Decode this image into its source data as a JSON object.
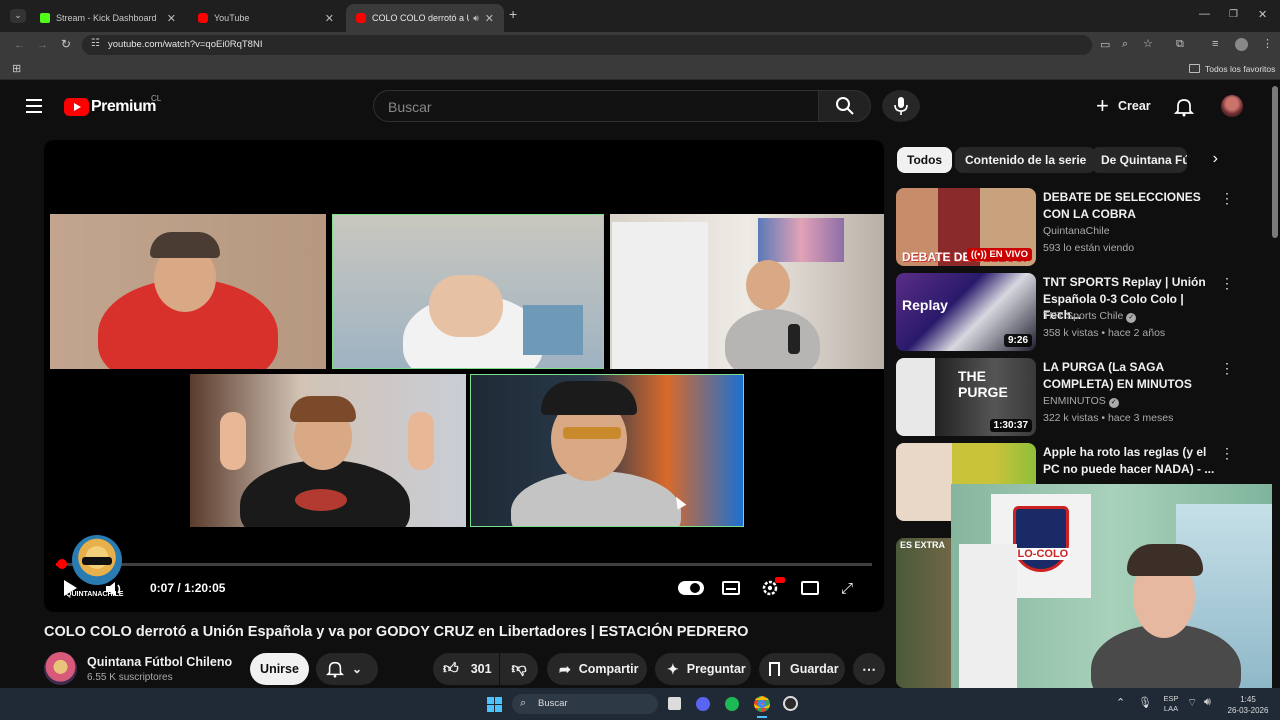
{
  "browser": {
    "tabs": [
      {
        "title": "Stream - Kick Dashboard",
        "favicon_color": "#53fc18"
      },
      {
        "title": "YouTube",
        "favicon_color": "#ff0000"
      },
      {
        "title": "COLO COLO derrotó a Unión",
        "favicon_color": "#ff0000"
      }
    ],
    "url": "youtube.com/watch?v=qoEi0RqT8NI",
    "bookmarks_label": "Todos los favoritos"
  },
  "youtube": {
    "logo_text": "Premium",
    "country_code": "CL",
    "search_placeholder": "Buscar",
    "create_label": "Crear"
  },
  "player": {
    "time_current": "0:07",
    "time_separator": "/",
    "time_total": "1:20:05",
    "progress_fraction": 0.0015,
    "channel_watermark": "QUINTANACHILE"
  },
  "video": {
    "title": "COLO COLO derrotó a Unión Española y va por GODOY CRUZ en Libertadores | ESTACIÓN PEDRERO",
    "channel_name": "Quintana Fútbol Chileno",
    "subscribers": "6.55 K suscriptores",
    "join_label": "Unirse",
    "like_count": "301",
    "share_label": "Compartir",
    "ask_label": "Preguntar",
    "save_label": "Guardar"
  },
  "chips": [
    "Todos",
    "Contenido de la serie",
    "De Quintana Fút"
  ],
  "recommendations": [
    {
      "title": "DEBATE DE SELECCIONES CON LA COBRA",
      "channel": "QuintanaChile",
      "meta": "593 lo están viendo",
      "badge": "EN VIVO",
      "thumb_text": "DEBATE DE SELECCI",
      "verified": false
    },
    {
      "title": "TNT SPORTS Replay | Unión Española 0-3 Colo Colo | Fech...",
      "channel": "TNT Sports Chile",
      "meta": "358 k vistas • hace 2 años",
      "duration": "9:26",
      "thumb_text": "Replay",
      "verified": true
    },
    {
      "title": "LA PURGA (La SAGA COMPLETA) EN MINUTOS",
      "channel": "ENMINUTOS",
      "meta": "322 k vistas • hace 3 meses",
      "duration": "1:30:37",
      "thumb_text": "THE PURGE",
      "verified": true
    },
    {
      "title": "Apple ha roto las reglas (y el PC no puede hacer NADA) - ...",
      "channel": "",
      "meta": "",
      "thumb_text": "",
      "verified": false
    },
    {
      "title": "",
      "channel": "",
      "meta": "",
      "thumb_text": "ES EXTRA",
      "verified": false
    }
  ],
  "webcam_overlay": {
    "flag_text": "COLO-COLO"
  },
  "taskbar": {
    "search_label": "Buscar",
    "lang_top": "ESP",
    "lang_bottom": "LAA",
    "time": "1:45",
    "date": "26-03-2026"
  }
}
